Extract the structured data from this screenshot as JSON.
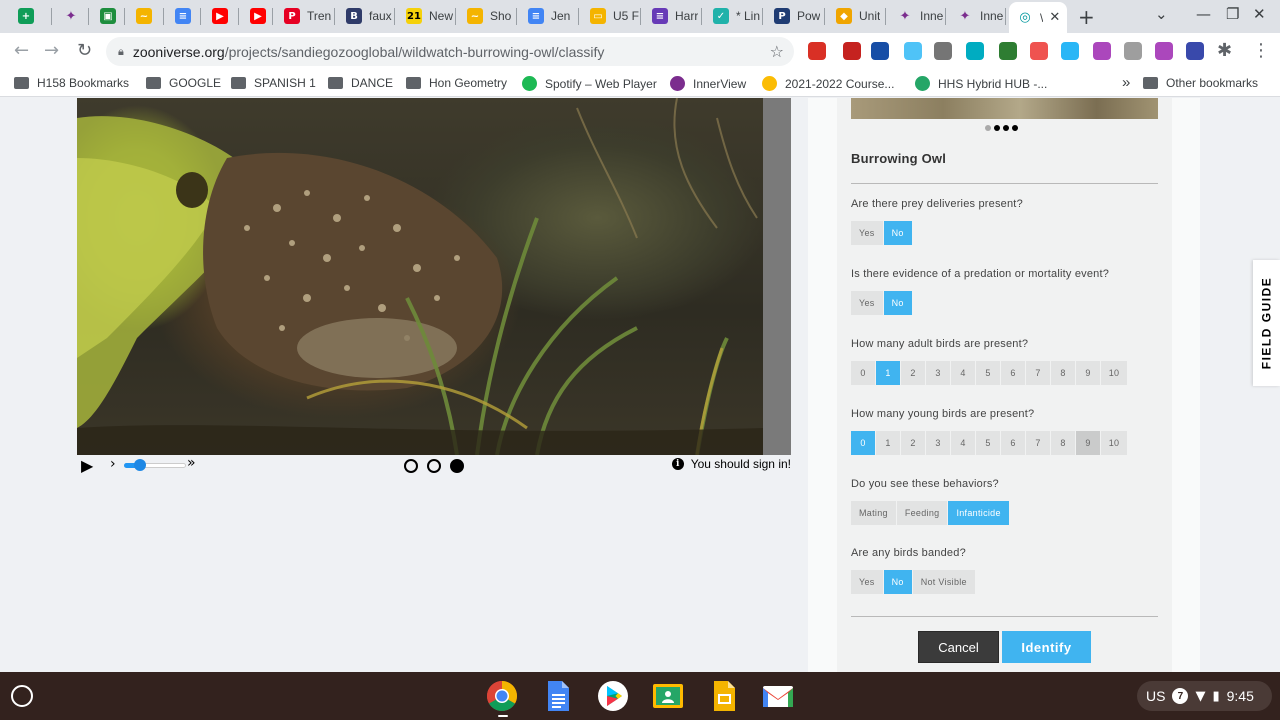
{
  "tabs": [
    {
      "title": "",
      "icon": "google-sheets-icon",
      "color": "#0f9d58",
      "glyph": "+"
    },
    {
      "title": "",
      "icon": "innerview-icon",
      "color": "#7b2d8e",
      "glyph": "✦"
    },
    {
      "title": "",
      "icon": "google-classroom-icon",
      "color": "#1e8e3e",
      "glyph": "▣"
    },
    {
      "title": "",
      "icon": "sandwich-icon",
      "color": "#f4b400",
      "glyph": "~"
    },
    {
      "title": "",
      "icon": "google-docs-icon",
      "color": "#4285f4",
      "glyph": "≡"
    },
    {
      "title": "",
      "icon": "youtube-icon",
      "color": "#ff0000",
      "glyph": "▶"
    },
    {
      "title": "",
      "icon": "youtube-icon",
      "color": "#ff0000",
      "glyph": "▶"
    },
    {
      "title": "Tren",
      "icon": "pinterest-icon",
      "color": "#e60023",
      "glyph": "P"
    },
    {
      "title": "faux",
      "icon": "b-icon",
      "color": "#2f3b69",
      "glyph": "B"
    },
    {
      "title": "New",
      "icon": "21-icon",
      "color": "#f5d10a",
      "glyph": "21"
    },
    {
      "title": "Sho",
      "icon": "sandwich-icon",
      "color": "#f4b400",
      "glyph": "~"
    },
    {
      "title": "Jen",
      "icon": "google-docs-icon",
      "color": "#4285f4",
      "glyph": "≡"
    },
    {
      "title": "U5 F",
      "icon": "google-slides-icon",
      "color": "#f4b400",
      "glyph": "▭"
    },
    {
      "title": "Harr",
      "icon": "google-forms-icon",
      "color": "#673ab7",
      "glyph": "≡"
    },
    {
      "title": "* Lin",
      "icon": "linkit-icon",
      "color": "#20b2aa",
      "glyph": "✓"
    },
    {
      "title": "Pow",
      "icon": "p-icon",
      "color": "#1f3c73",
      "glyph": "P"
    },
    {
      "title": "Unit",
      "icon": "shield-icon",
      "color": "#f0a500",
      "glyph": "◆"
    },
    {
      "title": "Inne",
      "icon": "innerview-icon",
      "color": "#7b2d8e",
      "glyph": "✦"
    },
    {
      "title": "Inne",
      "icon": "innerview-icon",
      "color": "#7b2d8e",
      "glyph": "✦"
    },
    {
      "title": "\\",
      "icon": "zooniverse-icon",
      "color": "#00979d",
      "glyph": "◎"
    }
  ],
  "url": {
    "host": "zooniverse.org",
    "path": "/projects/sandiegozooglobal/wildwatch-burrowing-owl/classify"
  },
  "bookmarks": [
    {
      "label": "H158 Bookmarks",
      "icon": "bookmark-folder-icon"
    },
    {
      "label": "GOOGLE",
      "icon": "folder-icon"
    },
    {
      "label": "SPANISH 1",
      "icon": "folder-icon"
    },
    {
      "label": "DANCE",
      "icon": "folder-icon"
    },
    {
      "label": "Hon Geometry",
      "icon": "folder-icon"
    },
    {
      "label": "Spotify – Web Player",
      "icon": "spotify-icon"
    },
    {
      "label": "InnerView",
      "icon": "innerview-icon"
    },
    {
      "label": "2021-2022 Course...",
      "icon": "google-drive-icon"
    },
    {
      "label": "HHS Hybrid HUB -...",
      "icon": "google-classroom-icon"
    },
    {
      "label": "Other bookmarks",
      "icon": "folder-icon"
    }
  ],
  "bookmarks_overflow": "»",
  "player": {
    "signin_text": "You should sign in!",
    "frames": 3,
    "current_frame": 3
  },
  "panel": {
    "title": "Burrowing Owl",
    "questions": [
      {
        "text": "Are there prey deliveries present?",
        "options": [
          "Yes",
          "No"
        ],
        "selected": "No"
      },
      {
        "text": "Is there evidence of a predation or mortality event?",
        "options": [
          "Yes",
          "No"
        ],
        "selected": "No"
      },
      {
        "text": "How many adult birds are present?",
        "options": [
          "0",
          "1",
          "2",
          "3",
          "4",
          "5",
          "6",
          "7",
          "8",
          "9",
          "10"
        ],
        "selected": "1"
      },
      {
        "text": "How many young birds are present?",
        "options": [
          "0",
          "1",
          "2",
          "3",
          "4",
          "5",
          "6",
          "7",
          "8",
          "9",
          "10"
        ],
        "selected": "0",
        "hover": "9"
      },
      {
        "text": "Do you see these behaviors?",
        "options": [
          "Mating",
          "Feeding",
          "Infanticide"
        ],
        "selected": "Infanticide"
      },
      {
        "text": "Are any birds banded?",
        "options": [
          "Yes",
          "No",
          "Not Visible"
        ],
        "selected": "No"
      }
    ],
    "cancel_label": "Cancel",
    "identify_label": "Identify"
  },
  "field_guide_label": "FIELD GUIDE",
  "tray": {
    "lang": "US",
    "notifications": "7",
    "time": "9:45"
  },
  "colors": {
    "accent": "#40b4f0",
    "cancel": "#3b3b3b",
    "shelf": "#33221e"
  }
}
